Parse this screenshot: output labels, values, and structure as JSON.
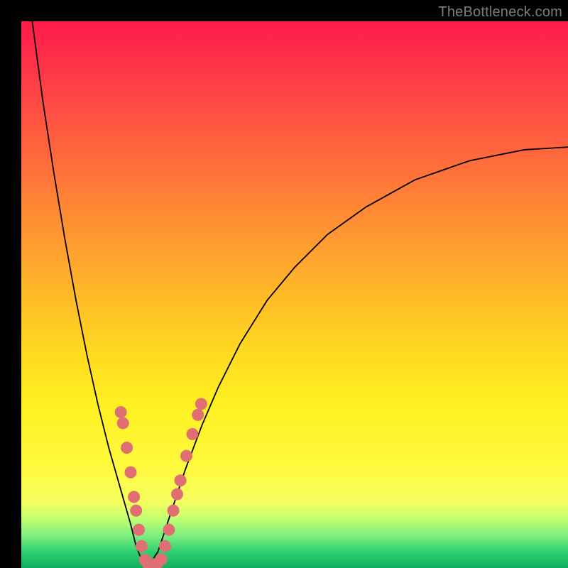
{
  "watermark": "TheBottleneck.com",
  "chart_data": {
    "type": "line",
    "title": "",
    "xlabel": "",
    "ylabel": "",
    "xlim": [
      0,
      100
    ],
    "ylim": [
      0,
      100
    ],
    "series": [
      {
        "name": "left-branch",
        "x": [
          2,
          4,
          6,
          8,
          10,
          12,
          14,
          16,
          18,
          20,
          21,
          22,
          23
        ],
        "y": [
          100,
          85,
          72,
          60,
          49,
          39,
          30,
          22,
          15,
          8,
          4,
          1.5,
          0
        ]
      },
      {
        "name": "right-branch",
        "x": [
          23,
          25,
          27,
          30,
          33,
          36,
          40,
          45,
          50,
          56,
          63,
          72,
          82,
          92,
          100
        ],
        "y": [
          0,
          3,
          9,
          18,
          26,
          33,
          41,
          49,
          55,
          61,
          66,
          71,
          74.5,
          76.5,
          77
        ]
      }
    ],
    "dots_left": [
      {
        "x": 18.2,
        "y": 28.5
      },
      {
        "x": 18.6,
        "y": 26.5
      },
      {
        "x": 19.3,
        "y": 22.0
      },
      {
        "x": 20.0,
        "y": 17.5
      },
      {
        "x": 20.6,
        "y": 13.0
      },
      {
        "x": 21.0,
        "y": 10.5
      },
      {
        "x": 21.5,
        "y": 7.0
      },
      {
        "x": 22.0,
        "y": 4.0
      },
      {
        "x": 22.6,
        "y": 1.5
      },
      {
        "x": 23.2,
        "y": 0.7
      },
      {
        "x": 24.0,
        "y": 0.7
      },
      {
        "x": 24.8,
        "y": 0.7
      }
    ],
    "dots_right": [
      {
        "x": 25.6,
        "y": 1.6
      },
      {
        "x": 26.3,
        "y": 4.0
      },
      {
        "x": 27.0,
        "y": 7.0
      },
      {
        "x": 27.8,
        "y": 10.5
      },
      {
        "x": 28.5,
        "y": 13.5
      },
      {
        "x": 29.1,
        "y": 16.0
      },
      {
        "x": 30.2,
        "y": 20.5
      },
      {
        "x": 31.3,
        "y": 24.5
      },
      {
        "x": 32.3,
        "y": 28.0
      },
      {
        "x": 32.9,
        "y": 30.0
      }
    ],
    "gradient_stops": [
      {
        "pos": 0.0,
        "color": "#ff1a4a"
      },
      {
        "pos": 0.5,
        "color": "#ffb928"
      },
      {
        "pos": 0.82,
        "color": "#fffa40"
      },
      {
        "pos": 1.0,
        "color": "#10b060"
      }
    ]
  }
}
